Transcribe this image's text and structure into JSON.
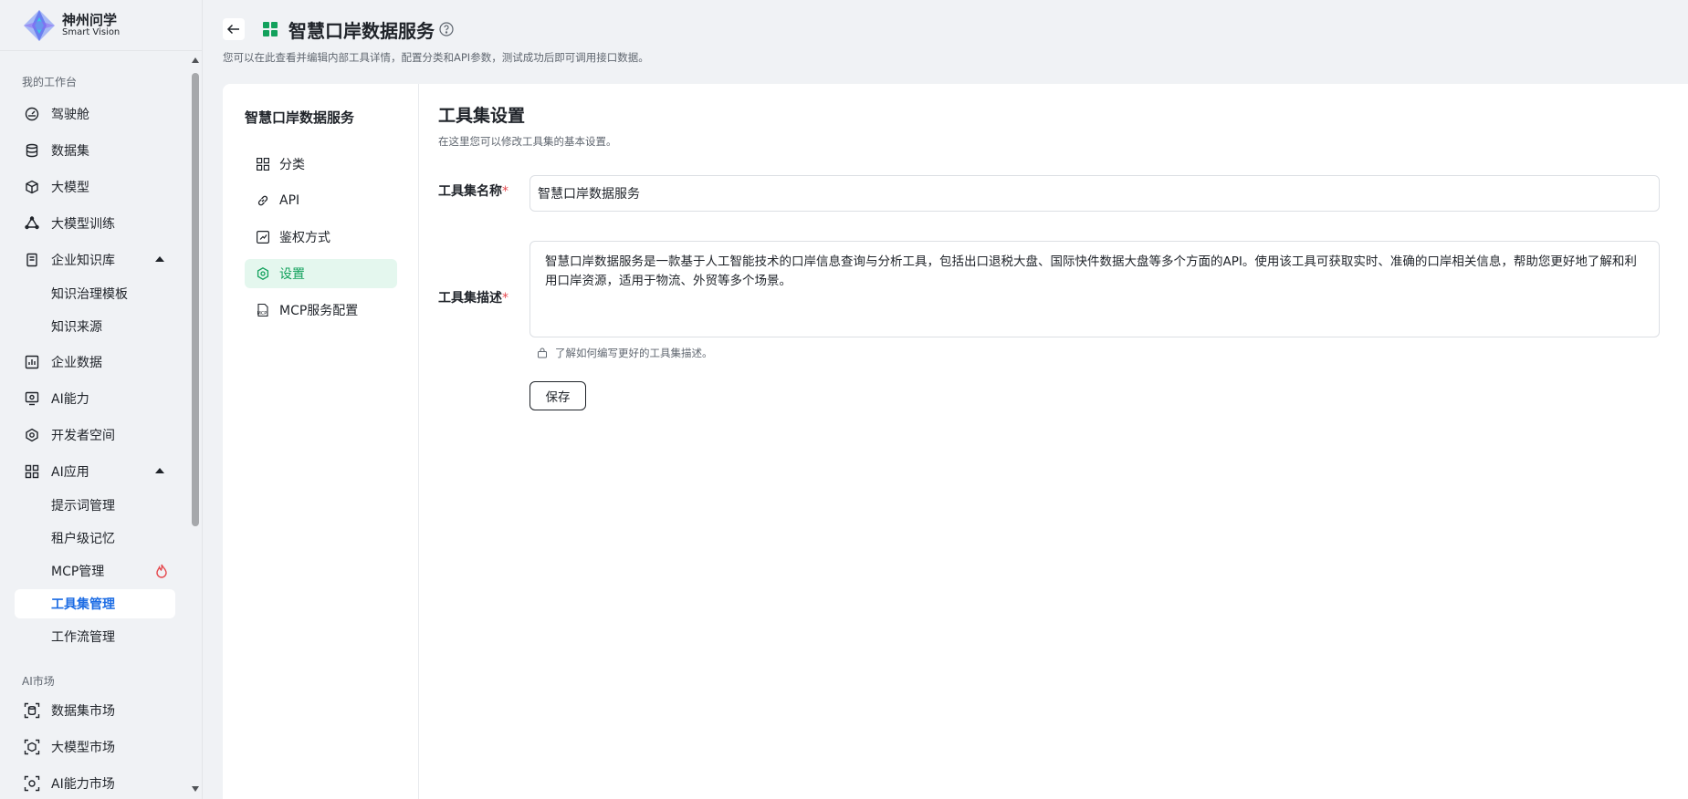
{
  "brand": {
    "title": "神州问学",
    "subtitle": "Smart Vision"
  },
  "sidebar": {
    "section_workspace": "我的工作台",
    "section_market": "AI市场",
    "items": [
      {
        "label": "驾驶舱",
        "icon": "dashboard-icon"
      },
      {
        "label": "数据集",
        "icon": "database-icon"
      },
      {
        "label": "大模型",
        "icon": "cube-icon"
      },
      {
        "label": "大模型训练",
        "icon": "training-icon"
      },
      {
        "label": "企业知识库",
        "icon": "knowledge-icon",
        "expanded": true
      },
      {
        "label": "知识治理模板",
        "sub": true
      },
      {
        "label": "知识来源",
        "sub": true
      },
      {
        "label": "企业数据",
        "icon": "chart-icon"
      },
      {
        "label": "AI能力",
        "icon": "ai-ability-icon"
      },
      {
        "label": "开发者空间",
        "icon": "developer-icon"
      },
      {
        "label": "AI应用",
        "icon": "apps-grid-icon",
        "expanded": true
      },
      {
        "label": "提示词管理",
        "sub": true
      },
      {
        "label": "租户级记忆",
        "sub": true
      },
      {
        "label": "MCP管理",
        "sub": true,
        "badge_icon": "fire-icon"
      },
      {
        "label": "工具集管理",
        "sub": true,
        "active": true
      },
      {
        "label": "工作流管理",
        "sub": true
      },
      {
        "label": "数据集市场",
        "icon": "dataset-market-icon"
      },
      {
        "label": "大模型市场",
        "icon": "model-market-icon"
      },
      {
        "label": "AI能力市场",
        "icon": "ability-market-icon"
      }
    ]
  },
  "header": {
    "title": "智慧口岸数据服务",
    "subtitle": "您可以在此查看并编辑内部工具详情，配置分类和API参数，测试成功后即可调用接口数据。"
  },
  "toolset_menu": {
    "title": "智慧口岸数据服务",
    "items": [
      {
        "label": "分类",
        "icon": "category-icon"
      },
      {
        "label": "API",
        "icon": "link-icon"
      },
      {
        "label": "鉴权方式",
        "icon": "auth-icon"
      },
      {
        "label": "设置",
        "icon": "settings-icon",
        "active": true
      },
      {
        "label": "MCP服务配置",
        "icon": "mcp-icon"
      }
    ]
  },
  "settings": {
    "title": "工具集设置",
    "subtitle": "在这里您可以修改工具集的基本设置。",
    "name_label": "工具集名称",
    "name_value": "智慧口岸数据服务",
    "desc_label": "工具集描述",
    "desc_value": "智慧口岸数据服务是一款基于人工智能技术的口岸信息查询与分析工具，包括出口退税大盘、国际快件数据大盘等多个方面的API。使用该工具可获取实时、准确的口岸相关信息，帮助您更好地了解和利用口岸资源，适用于物流、外贸等多个场景。",
    "hint": "了解如何编写更好的工具集描述。",
    "save_label": "保存",
    "required_mark": "*"
  },
  "colors": {
    "accent_blue": "#1c6ce4",
    "accent_green": "#12a15c",
    "required": "#e5484d"
  }
}
